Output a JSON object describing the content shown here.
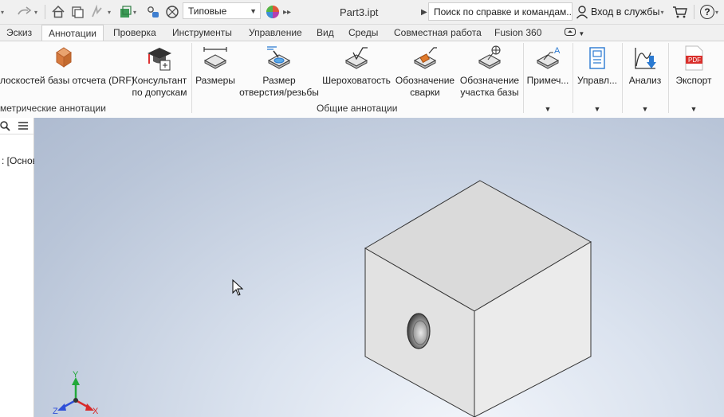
{
  "app": {
    "document_title": "Part3.ipt",
    "style_dropdown": "Типовые",
    "search_text": "Поиск по справке и командам...",
    "sign_in": "Вход в службы",
    "help_label": "?"
  },
  "tabs": [
    {
      "label": "Эскиз"
    },
    {
      "label": "Аннотации"
    },
    {
      "label": "Проверка"
    },
    {
      "label": "Инструменты"
    },
    {
      "label": "Управление"
    },
    {
      "label": "Вид"
    },
    {
      "label": "Среды"
    },
    {
      "label": "Совместная работа"
    },
    {
      "label": "Fusion 360"
    }
  ],
  "ribbon": {
    "drf_label": "лоскостей базы отсчета (DRF)",
    "consultant_line1": "Консультант",
    "consultant_line2": "по допускам",
    "dims_label": "Размеры",
    "hole_line1": "Размер",
    "hole_line2": "отверстия/резьбы",
    "rough_label": "Шероховатость",
    "weld_line1": "Обозначение",
    "weld_line2": "сварки",
    "datum_line1": "Обозначение",
    "datum_line2": "участка базы",
    "note_label": "Примеч...",
    "manage_label": "Управл...",
    "analysis_label": "Анализ",
    "export_label": "Экспорт",
    "panel_geometric": "метрические аннотации",
    "panel_general": "Общие аннотации",
    "pdf_badge": "PDF"
  },
  "browser": {
    "label": ": [Основ"
  },
  "axes": {
    "x": "X",
    "y": "Y",
    "z": "Z"
  },
  "colors": {
    "axis_x": "#d82a2a",
    "axis_y": "#22a83a",
    "axis_z": "#2f4fd8",
    "accent_blue": "#1f6fb7"
  }
}
